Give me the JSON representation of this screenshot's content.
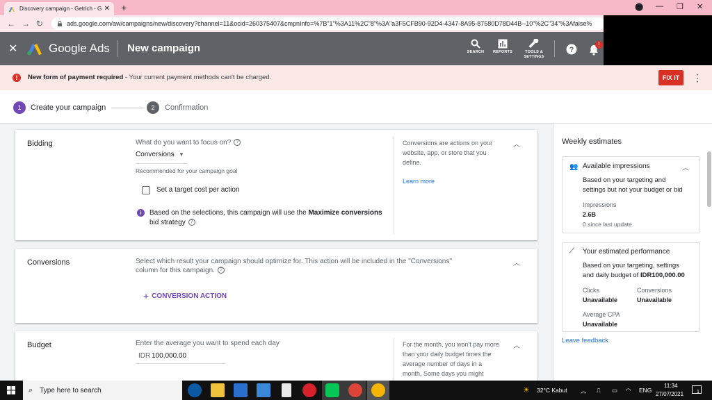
{
  "browser": {
    "tab_title": "Discovery campaign - Getrich - G",
    "url": "ads.google.com/aw/campaigns/new/discovery?channel=11&ocid=260375407&cmpnInfo=%7B\"1\"%3A11%2C\"8\"%3A\"a3F5CFB90-92D4-4347-8A95-87580D78D44B--10\"%2C\"34\"%3Afalse%"
  },
  "header": {
    "brand": "Google Ads",
    "page_title": "New campaign",
    "search_label": "SEARCH",
    "reports_label": "REPORTS",
    "tools_label_1": "TOOLS &",
    "tools_label_2": "SETTINGS",
    "bell_badge": "!"
  },
  "banner": {
    "bold": "New form of payment required",
    "rest": " - Your current payment methods can't be charged.",
    "fix_label": "FIX IT"
  },
  "stepper": {
    "step1_num": "1",
    "step1_label": "Create your campaign",
    "step2_num": "2",
    "step2_label": "Confirmation"
  },
  "bidding": {
    "section": "Bidding",
    "question": "What do you want to focus on?",
    "selected": "Conversions",
    "hint": "Recommended for your campaign goal",
    "checkbox_label": "Set a target cost per action",
    "info_pre": "Based on the selections, this campaign will use the ",
    "info_bold": "Maximize conversions",
    "info_post": "bid strategy",
    "side_text_1": "Conversions are actions on your",
    "side_text_2": "website, app, or store that you",
    "side_text_3": "define.",
    "learn_more": "Learn more"
  },
  "conversions": {
    "section": "Conversions",
    "desc_1": "Select which result your campaign should optimize for. This action will be included in the \"Conversions\"",
    "desc_2": "column for this campaign.",
    "action_label": "CONVERSION ACTION"
  },
  "budget": {
    "section": "Budget",
    "prompt": "Enter the average you want to spend each day",
    "currency": "IDR",
    "amount": "100,000.00",
    "side_1": "For the month, you won't pay more",
    "side_2": "than your daily budget times the",
    "side_3": "average number of days in a",
    "side_4": "month. Some days you might"
  },
  "sidebar": {
    "title": "Weekly estimates",
    "impressions_card": {
      "title": "Available impressions",
      "desc_1": "Based on your targeting and",
      "desc_2": "settings but not your budget or bid",
      "metric_label": "Impressions",
      "metric_value": "2.6B",
      "update": "0 since last update"
    },
    "performance_card": {
      "title": "Your estimated performance",
      "desc_1": "Based on your targeting, settings",
      "desc_2": "and daily budget of ",
      "desc_bold": "IDR100,000.00",
      "clicks_label": "Clicks",
      "clicks_value": "Unavailable",
      "conv_label": "Conversions",
      "conv_value": "Unavailable",
      "cpa_label": "Average CPA",
      "cpa_value": "Unavailable"
    },
    "feedback": "Leave feedback"
  },
  "taskbar": {
    "search_placeholder": "Type here to search",
    "weather": "32°C  Kabut",
    "lang": "ENG",
    "time": "11:34",
    "date": "27/07/2021",
    "notif_count": "1"
  },
  "colors": {
    "accent": "#1a73e8",
    "step_active": "#7248b9",
    "step_inactive": "#5f6368",
    "error": "#d93025",
    "ads_header": "#5f6368",
    "chrome_tabstrip": "#f7b8c8"
  }
}
